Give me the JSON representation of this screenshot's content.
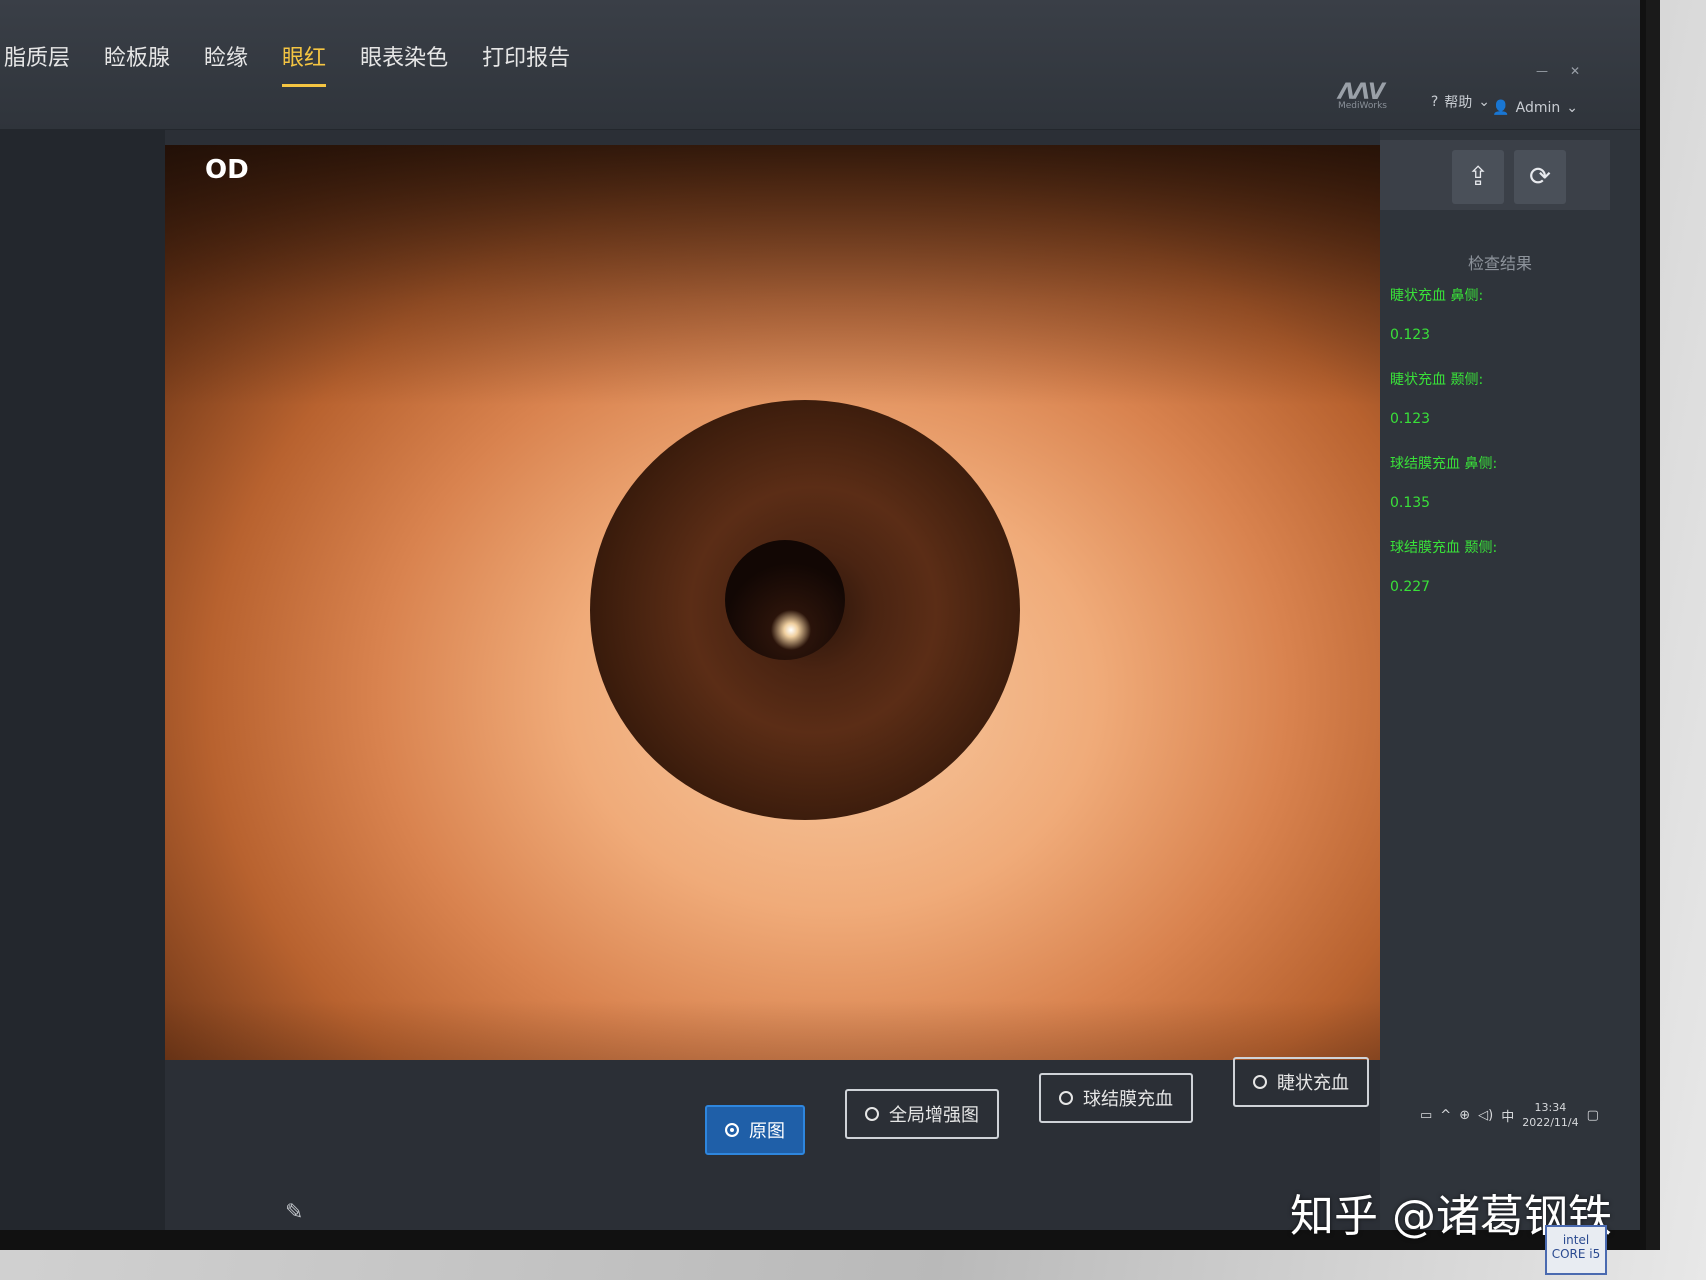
{
  "nav": {
    "tabs": [
      {
        "label": "脂质层",
        "active": false
      },
      {
        "label": "睑板腺",
        "active": false
      },
      {
        "label": "睑缘",
        "active": false
      },
      {
        "label": "眼红",
        "active": true
      },
      {
        "label": "眼表染色",
        "active": false
      },
      {
        "label": "打印报告",
        "active": false
      }
    ],
    "brand": "MediWorks",
    "help": "帮助",
    "user": "Admin"
  },
  "viewer": {
    "eye_label": "OD"
  },
  "results": {
    "title": "检查结果",
    "items": [
      {
        "label": "睫状充血 鼻侧:",
        "value": "0.123"
      },
      {
        "label": "睫状充血 颞侧:",
        "value": "0.123"
      },
      {
        "label": "球结膜充血 鼻侧:",
        "value": "0.135"
      },
      {
        "label": "球结膜充血 颞侧:",
        "value": "0.227"
      }
    ]
  },
  "modes": [
    {
      "label": "原图",
      "selected": true
    },
    {
      "label": "全局增强图",
      "selected": false
    },
    {
      "label": "球结膜充血",
      "selected": false
    },
    {
      "label": "睫状充血",
      "selected": false
    }
  ],
  "tray": {
    "time": "13:34",
    "date": "2022/11/4",
    "ime": "中"
  },
  "watermark": "知乎 @诸葛钢铁",
  "intel_badge": "intel CORE i5",
  "colors": {
    "accent_tab": "#f5c542",
    "result_text": "#39e039",
    "selected_mode": "#1f5fa8"
  }
}
